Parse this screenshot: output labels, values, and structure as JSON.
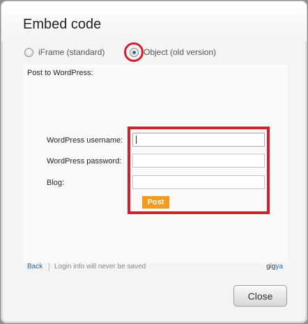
{
  "dialog": {
    "title": "Embed code"
  },
  "embed_options": {
    "option_iframe": "iFrame (standard)",
    "option_object": "Object (old version)",
    "selected": "Object (old version)"
  },
  "wordpress": {
    "heading": "Post to WordPress:",
    "username_label": "WordPress username:",
    "username_value": "",
    "password_label": "WordPress password:",
    "password_value": "",
    "blog_label": "Blog:",
    "blog_value": "",
    "post_label": "Post"
  },
  "footer": {
    "back_label": "Back",
    "note": "Login info will never be saved",
    "brand_part1": "gig",
    "brand_part2": "ya"
  },
  "actions": {
    "close_label": "Close"
  },
  "colors": {
    "highlight": "#d0202e",
    "post_button": "#f29b1d",
    "link": "#2a6496"
  }
}
